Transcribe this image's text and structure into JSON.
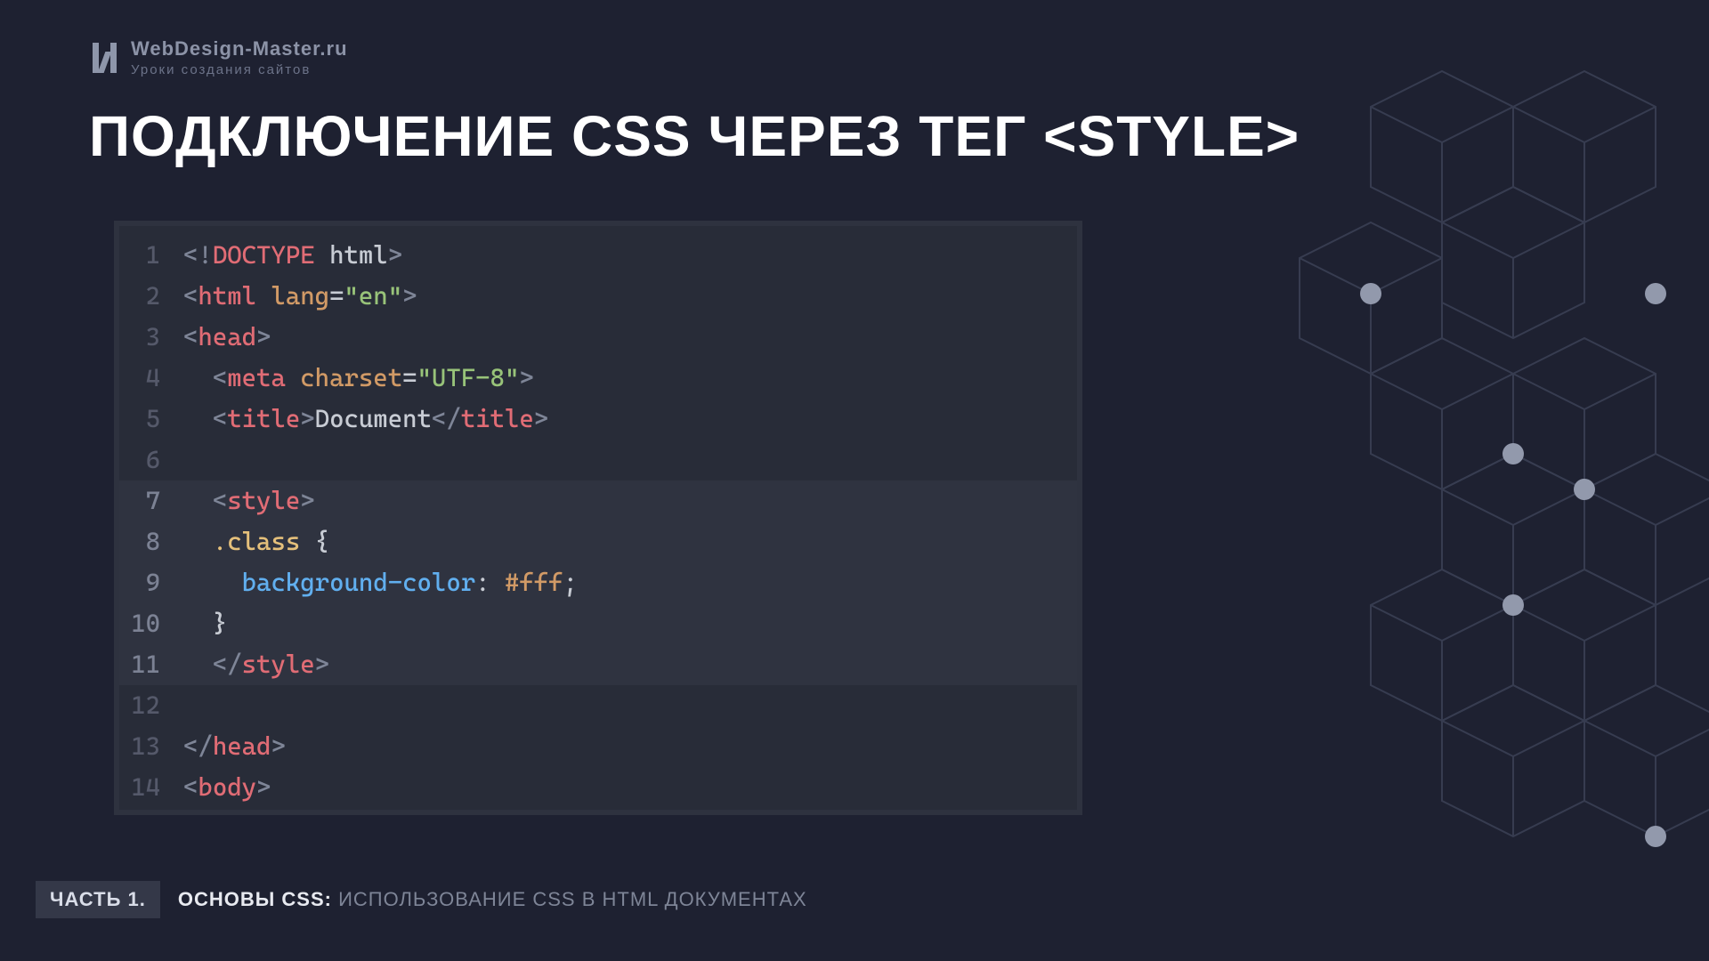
{
  "brand": {
    "name": "WebDesign-Master.ru",
    "tagline": "Уроки создания сайтов"
  },
  "title": "ПОДКЛЮЧЕНИЕ CSS ЧЕРЕЗ ТЕГ <STYLE>",
  "code": {
    "highlight_start": 7,
    "highlight_end": 11,
    "lines": [
      {
        "n": 1,
        "tokens": [
          [
            "<!",
            "gray"
          ],
          [
            "DOCTYPE",
            "red"
          ],
          [
            " html",
            "white"
          ],
          [
            ">",
            "gray"
          ]
        ]
      },
      {
        "n": 2,
        "tokens": [
          [
            "<",
            "gray"
          ],
          [
            "html",
            "red"
          ],
          [
            " lang",
            "orange"
          ],
          [
            "=",
            "white"
          ],
          [
            "\"en\"",
            "green"
          ],
          [
            ">",
            "gray"
          ]
        ]
      },
      {
        "n": 3,
        "tokens": [
          [
            "<",
            "gray"
          ],
          [
            "head",
            "red"
          ],
          [
            ">",
            "gray"
          ]
        ]
      },
      {
        "n": 4,
        "tokens": [
          [
            "  ",
            ""
          ],
          [
            "<",
            "gray"
          ],
          [
            "meta",
            "red"
          ],
          [
            " charset",
            "orange"
          ],
          [
            "=",
            "white"
          ],
          [
            "\"UTF-8\"",
            "green"
          ],
          [
            ">",
            "gray"
          ]
        ]
      },
      {
        "n": 5,
        "tokens": [
          [
            "  ",
            ""
          ],
          [
            "<",
            "gray"
          ],
          [
            "title",
            "red"
          ],
          [
            ">",
            "gray"
          ],
          [
            "Document",
            "white"
          ],
          [
            "</",
            "gray"
          ],
          [
            "title",
            "red"
          ],
          [
            ">",
            "gray"
          ]
        ]
      },
      {
        "n": 6,
        "tokens": [
          [
            "",
            ""
          ]
        ]
      },
      {
        "n": 7,
        "tokens": [
          [
            "  ",
            ""
          ],
          [
            "<",
            "gray"
          ],
          [
            "style",
            "red"
          ],
          [
            ">",
            "gray"
          ]
        ]
      },
      {
        "n": 8,
        "tokens": [
          [
            "  ",
            ""
          ],
          [
            ".class",
            "yellow"
          ],
          [
            " {",
            "white"
          ]
        ]
      },
      {
        "n": 9,
        "tokens": [
          [
            "    ",
            ""
          ],
          [
            "background-color",
            "blue"
          ],
          [
            ":",
            "white"
          ],
          [
            " #fff",
            "orange"
          ],
          [
            ";",
            "white"
          ]
        ]
      },
      {
        "n": 10,
        "tokens": [
          [
            "  ",
            ""
          ],
          [
            "}",
            "white"
          ]
        ]
      },
      {
        "n": 11,
        "tokens": [
          [
            "  ",
            ""
          ],
          [
            "</",
            "gray"
          ],
          [
            "style",
            "red"
          ],
          [
            ">",
            "gray"
          ]
        ]
      },
      {
        "n": 12,
        "tokens": [
          [
            "",
            ""
          ]
        ]
      },
      {
        "n": 13,
        "tokens": [
          [
            "</",
            "gray"
          ],
          [
            "head",
            "red"
          ],
          [
            ">",
            "gray"
          ]
        ]
      },
      {
        "n": 14,
        "tokens": [
          [
            "<",
            "gray"
          ],
          [
            "body",
            "red"
          ],
          [
            ">",
            "gray"
          ]
        ]
      }
    ]
  },
  "footer": {
    "part": "ЧАСТЬ 1.",
    "main": "ОСНОВЫ CSS:",
    "sub": "ИСПОЛЬЗОВАНИЕ CSS В HTML ДОКУМЕНТАХ"
  }
}
